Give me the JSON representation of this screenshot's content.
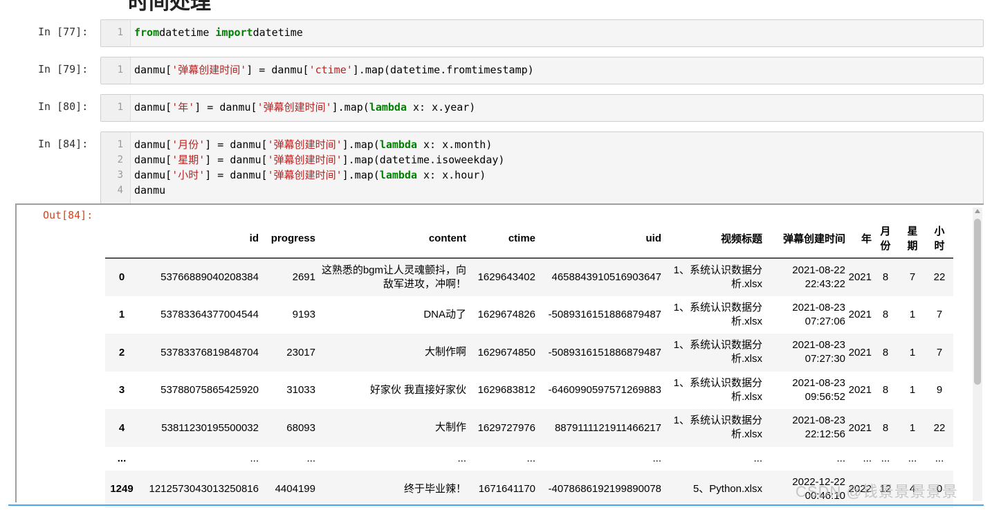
{
  "cells": [
    {
      "prompt": "In  [77]:",
      "lines": [
        {
          "n": "1",
          "t": [
            [
              "kw",
              "from"
            ],
            [
              "",
              "datetime "
            ],
            [
              "kw",
              "import"
            ],
            [
              "",
              "datetime"
            ]
          ]
        }
      ]
    },
    {
      "prompt": "In  [79]:",
      "lines": [
        {
          "n": "1",
          "t": [
            [
              "",
              "danmu["
            ],
            [
              "str",
              "'弹幕创建时间'"
            ],
            [
              "",
              "] = danmu["
            ],
            [
              "str",
              "'ctime'"
            ],
            [
              "",
              "].map(datetime.fromtimestamp)"
            ]
          ]
        }
      ]
    },
    {
      "prompt": "In  [80]:",
      "lines": [
        {
          "n": "1",
          "t": [
            [
              "",
              "danmu["
            ],
            [
              "str",
              "'年'"
            ],
            [
              "",
              "] = danmu["
            ],
            [
              "str",
              "'弹幕创建时间'"
            ],
            [
              "",
              "].map("
            ],
            [
              "kw",
              "lambda"
            ],
            [
              "",
              " x: x.year)"
            ]
          ]
        }
      ]
    },
    {
      "prompt": "In  [84]:",
      "lines": [
        {
          "n": "1",
          "t": [
            [
              "",
              "danmu["
            ],
            [
              "str",
              "'月份'"
            ],
            [
              "",
              "] = danmu["
            ],
            [
              "str",
              "'弹幕创建时间'"
            ],
            [
              "",
              "].map("
            ],
            [
              "kw",
              "lambda"
            ],
            [
              "",
              " x: x.month)"
            ]
          ]
        },
        {
          "n": "2",
          "t": [
            [
              "",
              "danmu["
            ],
            [
              "str",
              "'星期'"
            ],
            [
              "",
              "] = danmu["
            ],
            [
              "str",
              "'弹幕创建时间'"
            ],
            [
              "",
              "].map(datetime.isoweekday)"
            ]
          ]
        },
        {
          "n": "3",
          "t": [
            [
              "",
              "danmu["
            ],
            [
              "str",
              "'小时'"
            ],
            [
              "",
              "] = danmu["
            ],
            [
              "str",
              "'弹幕创建时间'"
            ],
            [
              "",
              "].map("
            ],
            [
              "kw",
              "lambda"
            ],
            [
              "",
              " x: x.hour)"
            ]
          ]
        },
        {
          "n": "4",
          "t": [
            [
              "",
              "danmu"
            ]
          ]
        }
      ]
    }
  ],
  "output": {
    "prompt": "Out[84]:",
    "columns": [
      "",
      "id",
      "progress",
      "content",
      "ctime",
      "uid",
      "视频标题",
      "弹幕创建时间",
      "年",
      "月份",
      "星期",
      "小时"
    ],
    "column_display": [
      "",
      "id",
      "progress",
      "content",
      "ctime",
      "uid",
      "视频标题",
      "弹幕创建时间",
      "年",
      "月\n份",
      "星\n期",
      "小\n时"
    ],
    "rows": [
      [
        "0",
        "53766889040208384",
        "2691",
        "这熟悉的bgm让人灵魂颤抖，向敌军进攻，冲啊！",
        "1629643402",
        "4658843910516903647",
        "1、系统认识数据分析.xlsx",
        "2021-08-22 22:43:22",
        "2021",
        "8",
        "7",
        "22"
      ],
      [
        "1",
        "53783364377004544",
        "9193",
        "DNA动了",
        "1629674826",
        "-5089316151886879487",
        "1、系统认识数据分析.xlsx",
        "2021-08-23 07:27:06",
        "2021",
        "8",
        "1",
        "7"
      ],
      [
        "2",
        "53783376819848704",
        "23017",
        "大制作啊",
        "1629674850",
        "-5089316151886879487",
        "1、系统认识数据分析.xlsx",
        "2021-08-23 07:27:30",
        "2021",
        "8",
        "1",
        "7"
      ],
      [
        "3",
        "53788075865425920",
        "31033",
        "好家伙 我直接好家伙",
        "1629683812",
        "-6460990597571269883",
        "1、系统认识数据分析.xlsx",
        "2021-08-23 09:56:52",
        "2021",
        "8",
        "1",
        "9"
      ],
      [
        "4",
        "53811230195500032",
        "68093",
        "大制作",
        "1629727976",
        "8879111121911466217",
        "1、系统认识数据分析.xlsx",
        "2021-08-23 22:12:56",
        "2021",
        "8",
        "1",
        "22"
      ],
      [
        "...",
        "...",
        "...",
        "...",
        "...",
        "...",
        "...",
        "...",
        "...",
        "...",
        "...",
        "..."
      ],
      [
        "1249",
        "1212573043013250816",
        "4404199",
        "终于毕业辣！",
        "1671641170",
        "-4078686192199890078",
        "5、Python.xlsx",
        "2022-12-22 00:46:10",
        "2022",
        "12",
        "4",
        "0"
      ]
    ]
  },
  "watermark": "CSDN @钱景景景景景"
}
